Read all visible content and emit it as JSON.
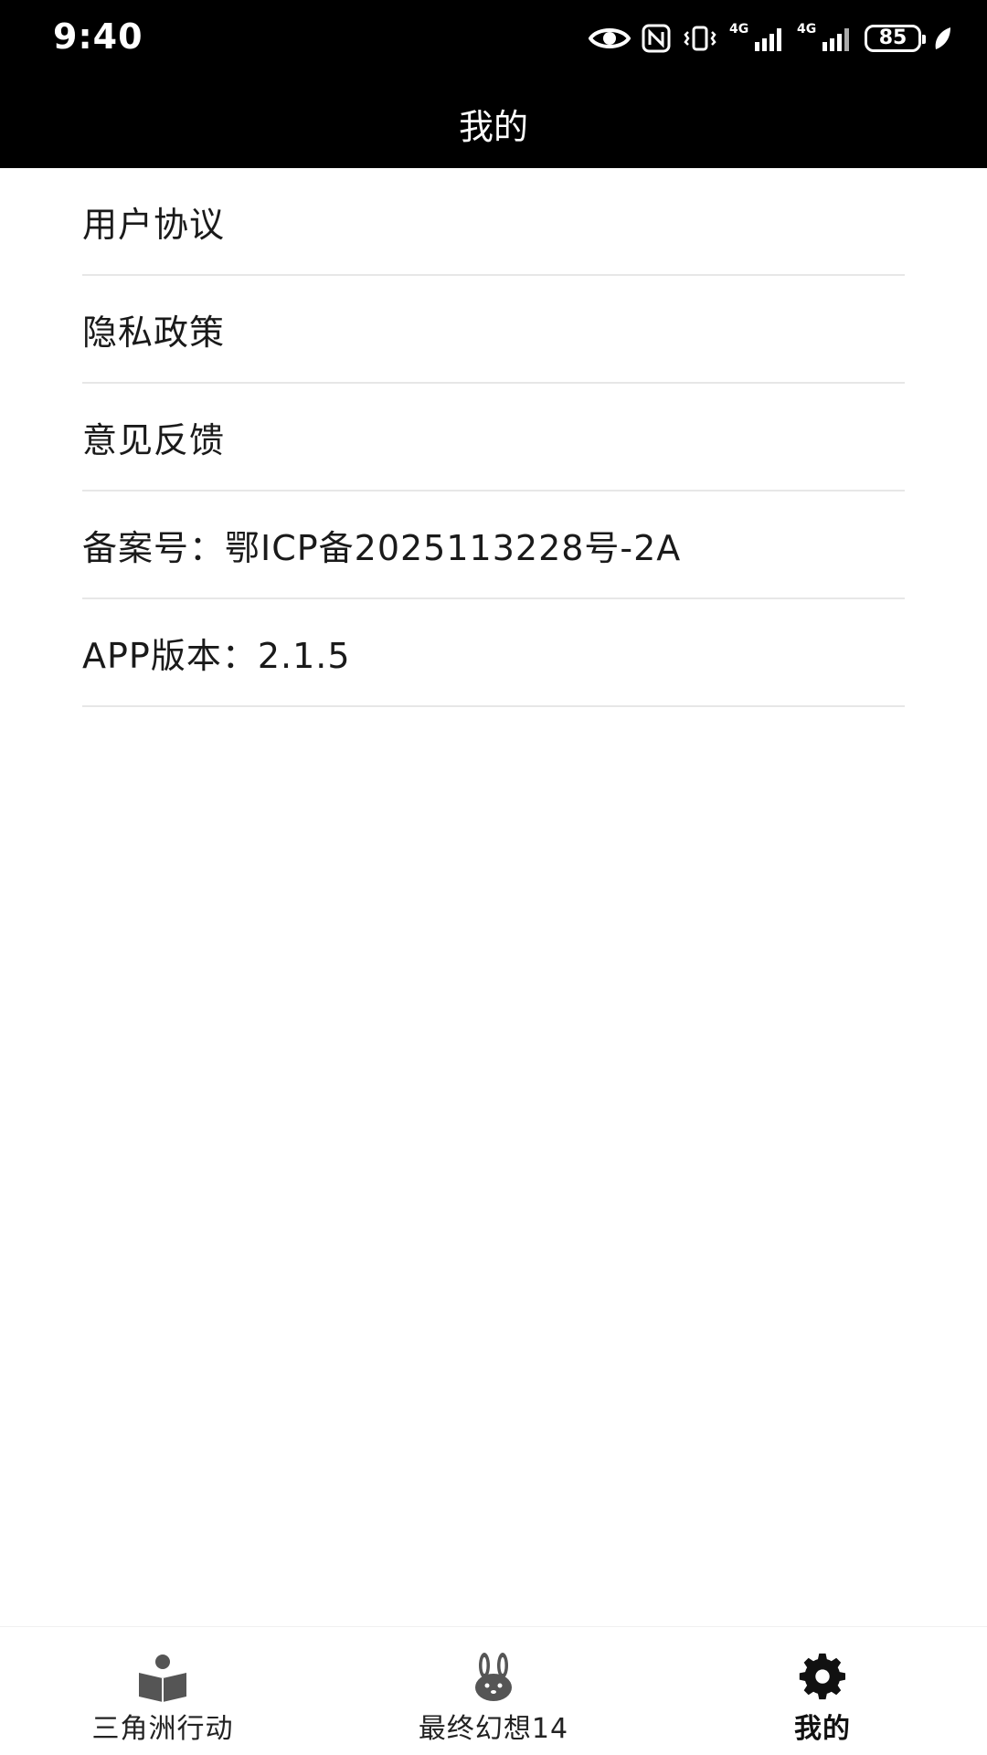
{
  "status_bar": {
    "time": "9:40",
    "network_1": "4G",
    "network_2": "4G",
    "battery": "85",
    "icons": [
      "eye-icon",
      "nfc-icon",
      "vibrate-icon",
      "signal-icon",
      "signal-icon",
      "battery-icon",
      "leaf-icon"
    ]
  },
  "header": {
    "title": "我的"
  },
  "menu": {
    "items": [
      {
        "label": "用户协议"
      },
      {
        "label": "隐私政策"
      },
      {
        "label": "意见反馈"
      },
      {
        "label": "备案号：鄂ICP备2025113228号-2A"
      },
      {
        "label": "APP版本：2.1.5"
      }
    ]
  },
  "bottom_nav": {
    "items": [
      {
        "label": "三角洲行动",
        "icon": "book-reader-icon"
      },
      {
        "label": "最终幻想14",
        "icon": "rabbit-icon"
      },
      {
        "label": "我的",
        "icon": "gear-icon",
        "active": true
      }
    ]
  },
  "colors": {
    "header_bg": "#000000",
    "divider": "#e7e7e7",
    "icon_gray": "#555555"
  }
}
